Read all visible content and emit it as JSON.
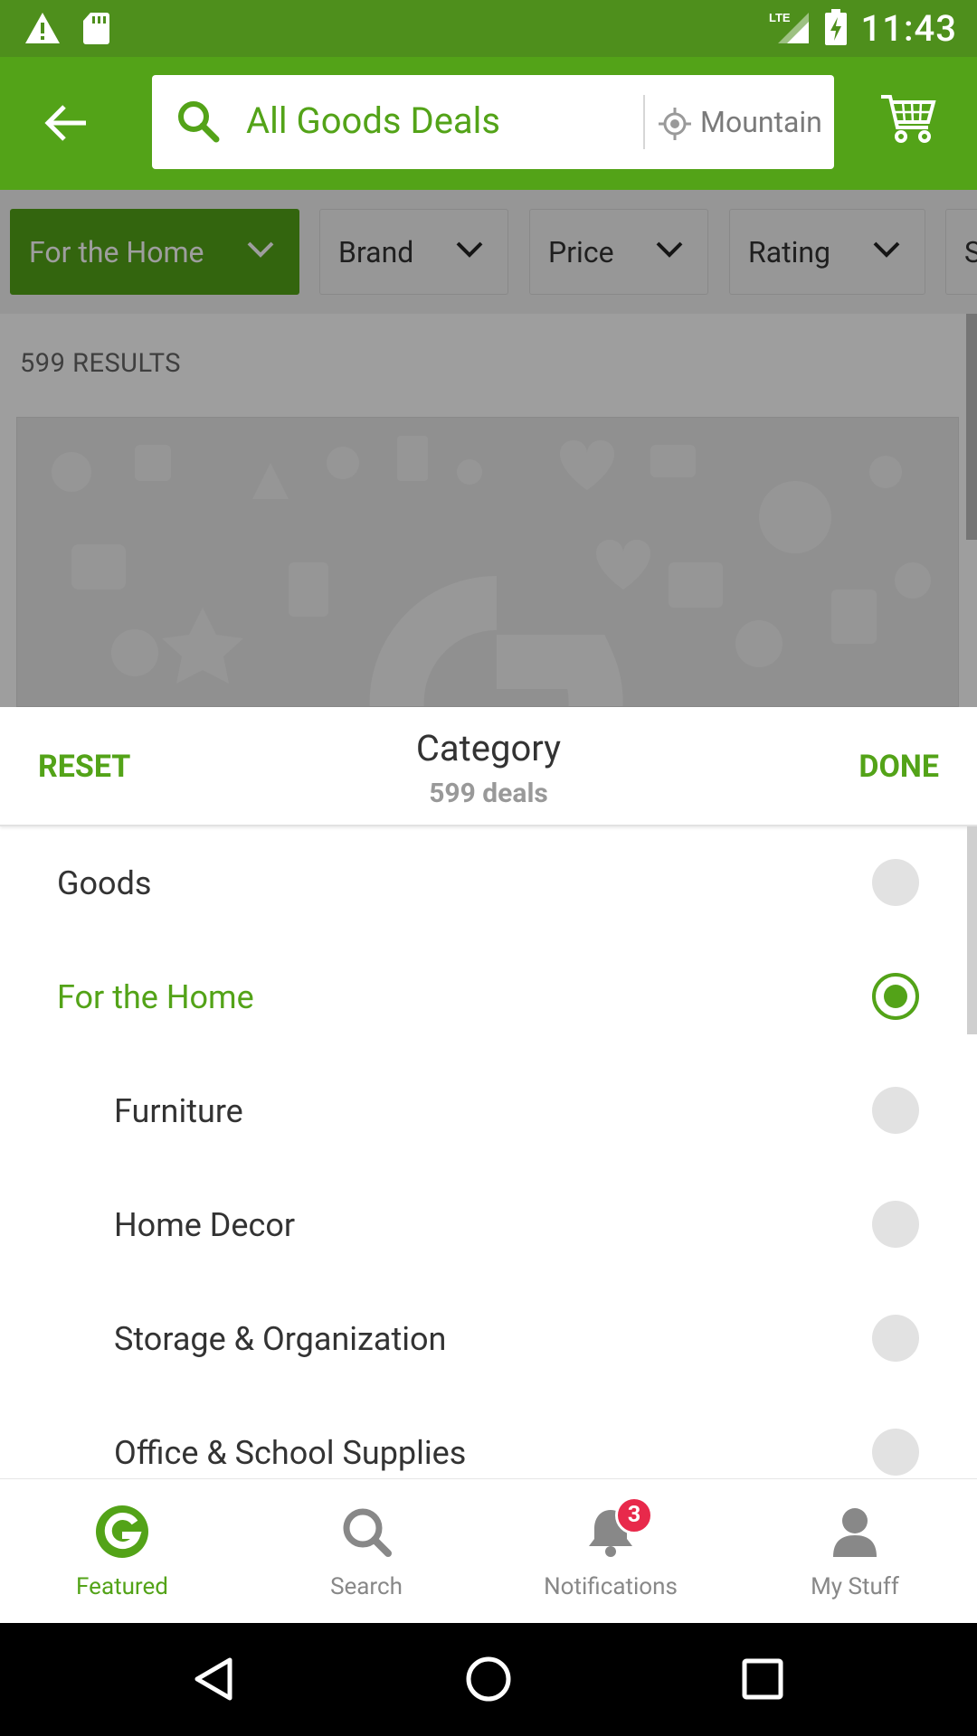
{
  "status_bar": {
    "time": "11:43",
    "network": "LTE",
    "icons": [
      "warning-icon",
      "sd-card-icon",
      "signal-icon",
      "battery-charging-icon"
    ]
  },
  "app_bar": {
    "search_text": "All Goods Deals",
    "location_text": "Mountain View",
    "icons": [
      "back-arrow-icon",
      "search-icon",
      "location-icon",
      "cart-icon"
    ]
  },
  "filters": [
    {
      "label": "For the Home",
      "active": true
    },
    {
      "label": "Brand",
      "active": false
    },
    {
      "label": "Price",
      "active": false
    },
    {
      "label": "Rating",
      "active": false
    },
    {
      "label": "S",
      "active": false
    }
  ],
  "content": {
    "results": "599 RESULTS"
  },
  "sheet": {
    "reset_label": "RESET",
    "done_label": "DONE",
    "title": "Category",
    "subtitle": "599 deals",
    "items": [
      {
        "label": "Goods",
        "selected": false,
        "level": 0
      },
      {
        "label": "For the Home",
        "selected": true,
        "level": 0
      },
      {
        "label": "Furniture",
        "selected": false,
        "level": 1
      },
      {
        "label": "Home Decor",
        "selected": false,
        "level": 1
      },
      {
        "label": "Storage & Organization",
        "selected": false,
        "level": 1
      },
      {
        "label": "Office & School Supplies",
        "selected": false,
        "level": 1
      }
    ]
  },
  "bottom_nav": {
    "items": [
      {
        "label": "Featured",
        "icon": "groupon-g-icon",
        "active": true
      },
      {
        "label": "Search",
        "icon": "search-icon",
        "active": false
      },
      {
        "label": "Notifications",
        "icon": "bell-icon",
        "active": false,
        "badge": "3"
      },
      {
        "label": "My Stuff",
        "icon": "person-icon",
        "active": false
      }
    ]
  },
  "colors": {
    "brand_green": "#53a318",
    "status_green": "#4e8f1c",
    "badge_red": "#e8294b"
  }
}
